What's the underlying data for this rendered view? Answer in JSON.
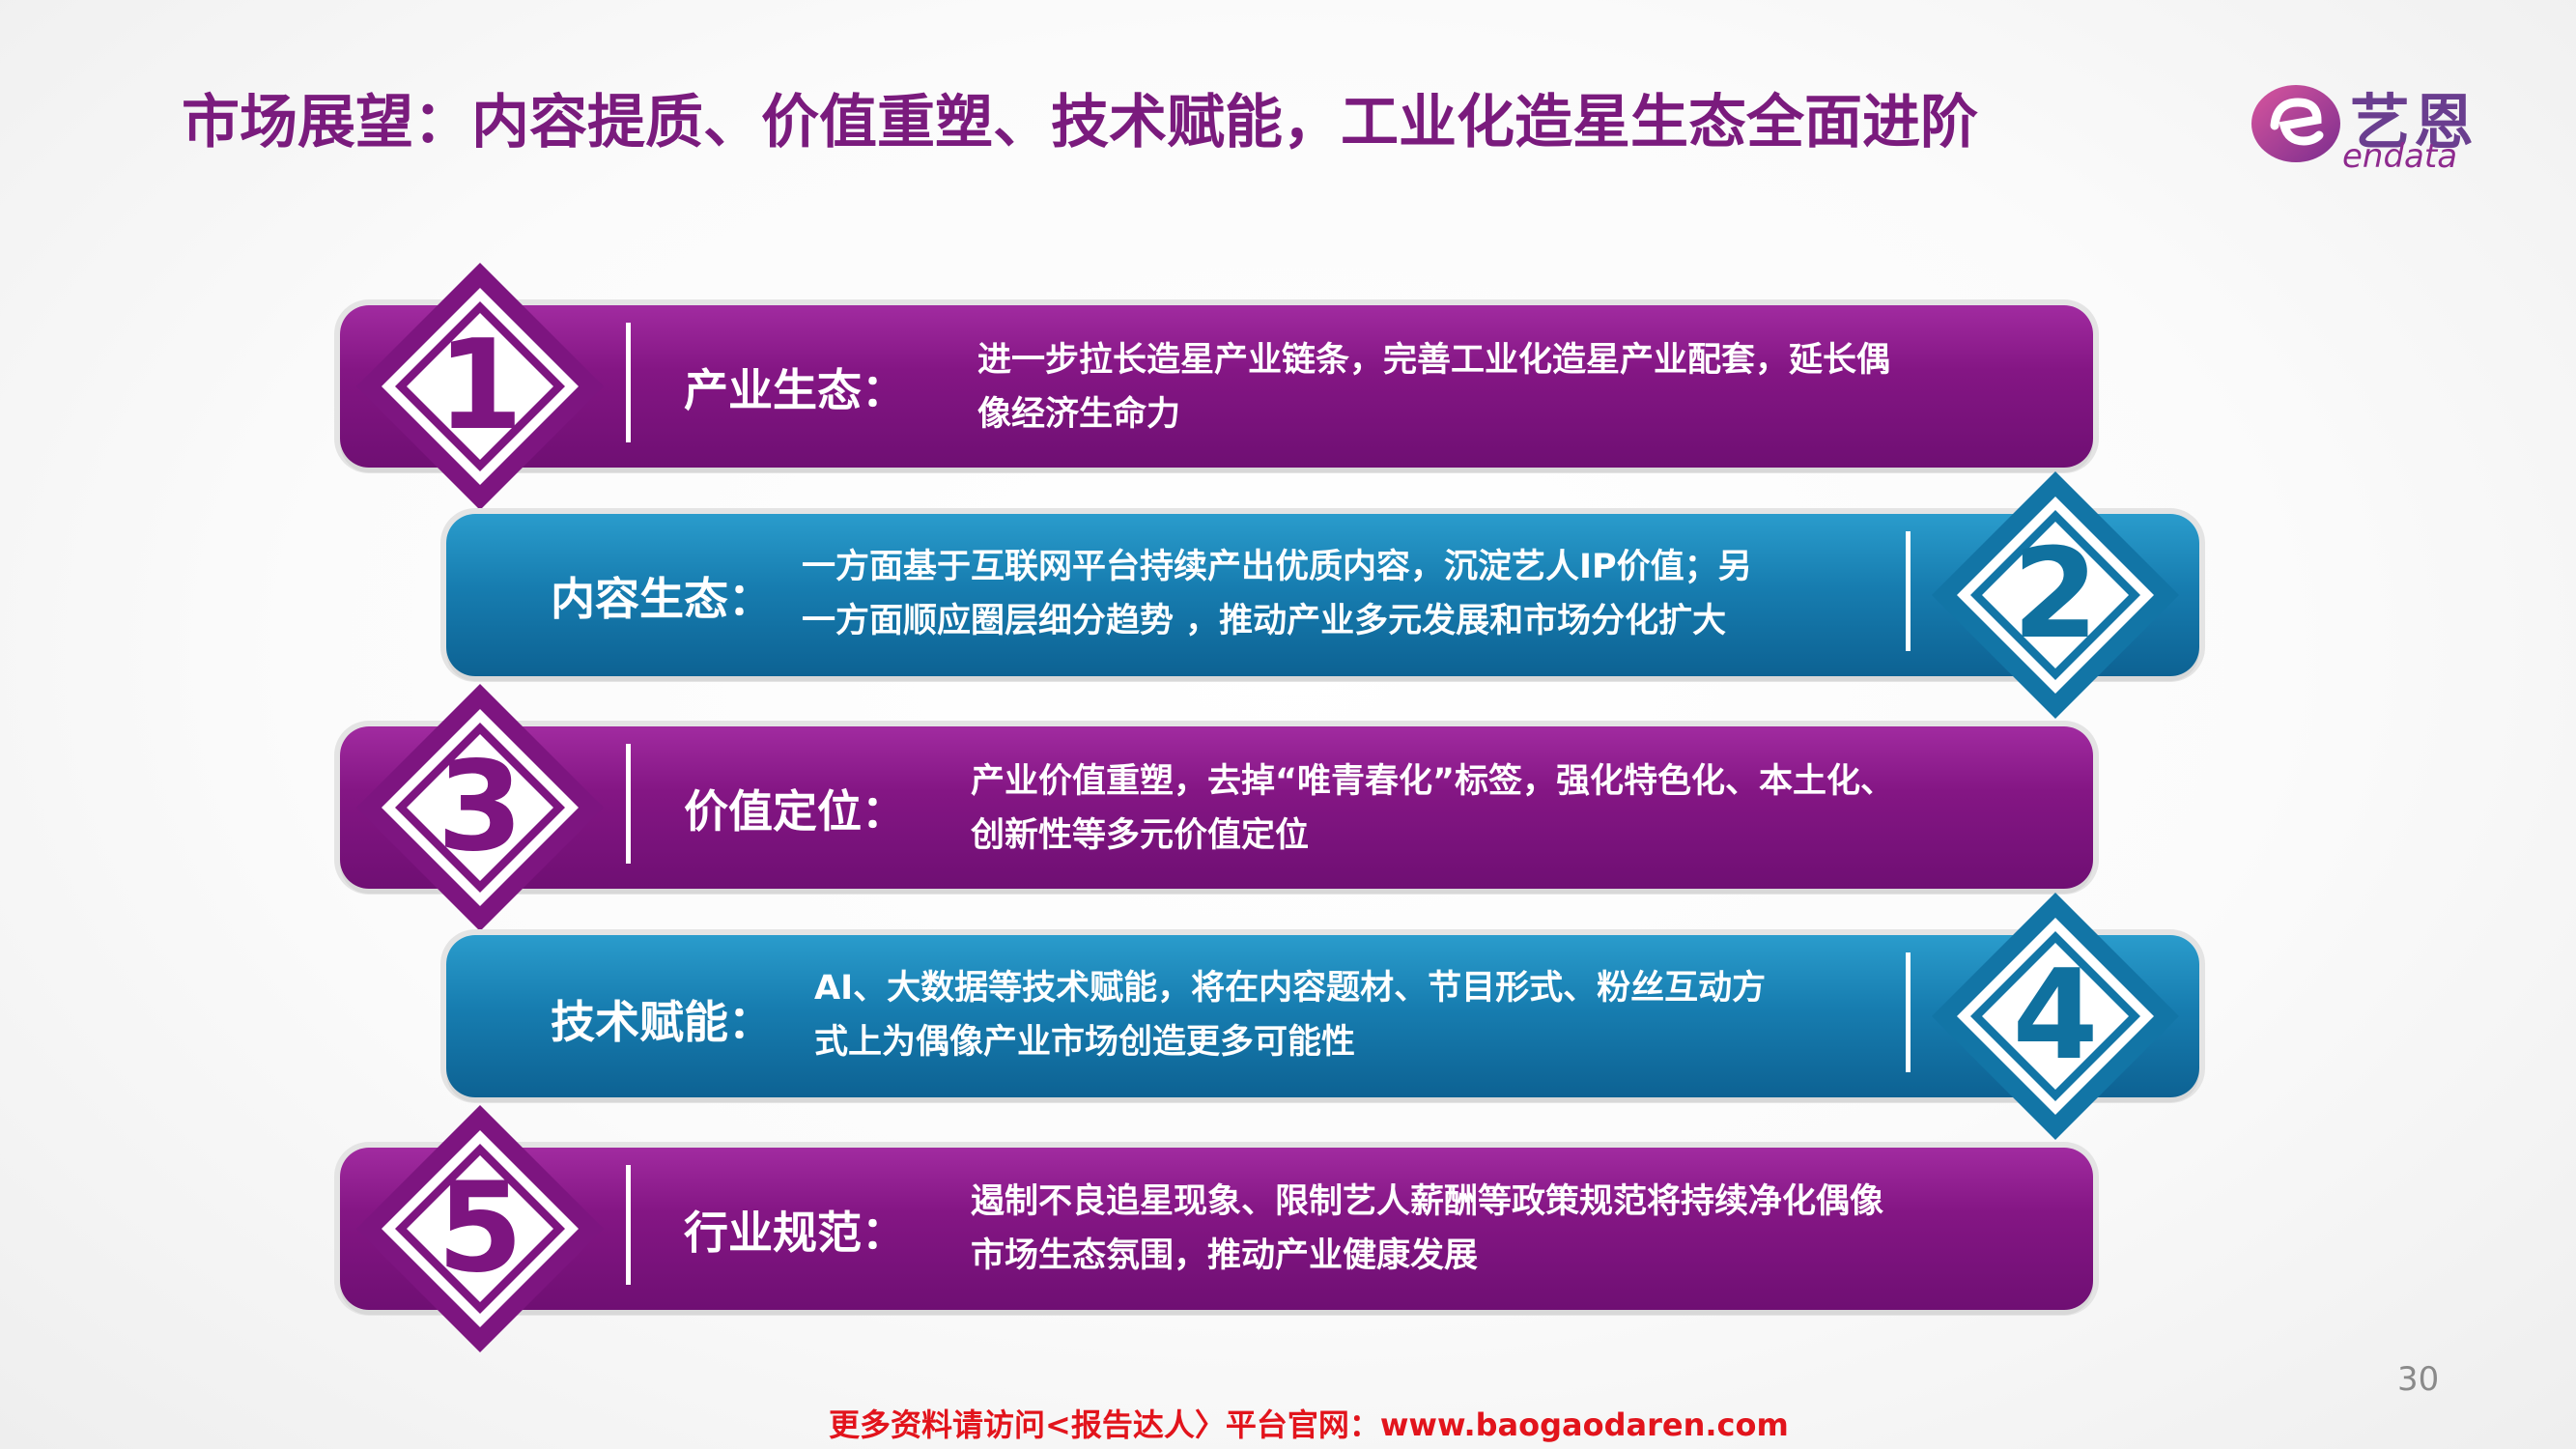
{
  "title": "市场展望：内容提质、价值重塑、技术赋能，工业化造星生态全面进阶",
  "logo": {
    "cn": "艺恩",
    "en": "endata"
  },
  "colors": {
    "purple": "#7d1580",
    "blue": "#1275a6",
    "title": "#7a1b7d",
    "footer": "#e2141c"
  },
  "items": [
    {
      "number": "1",
      "label": "产业生态：",
      "lines": [
        "进一步拉长造星产业链条，完善工业化造星产业配套，延长偶",
        "像经济生命力"
      ]
    },
    {
      "number": "2",
      "label": "内容生态：",
      "lines": [
        "一方面基于互联网平台持续产出优质内容，沉淀艺人IP价值；另",
        "一方面顺应圈层细分趋势 ，推动产业多元发展和市场分化扩大"
      ]
    },
    {
      "number": "3",
      "label": "价值定位：",
      "lines": [
        "产业价值重塑，去掉“唯青春化”标签，强化特色化、本土化、",
        "创新性等多元价值定位"
      ]
    },
    {
      "number": "4",
      "label": "技术赋能：",
      "lines": [
        "AI、大数据等技术赋能，将在内容题材、节目形式、粉丝互动方",
        "式上为偶像产业市场创造更多可能性"
      ]
    },
    {
      "number": "5",
      "label": "行业规范：",
      "lines": [
        "遏制不良追星现象、限制艺人薪酬等政策规范将持续净化偶像",
        "市场生态氛围，推动产业健康发展"
      ]
    }
  ],
  "page_number": "30",
  "footer": "更多资料请访问<报告达人〉平台官网：www.baogaodaren.com"
}
